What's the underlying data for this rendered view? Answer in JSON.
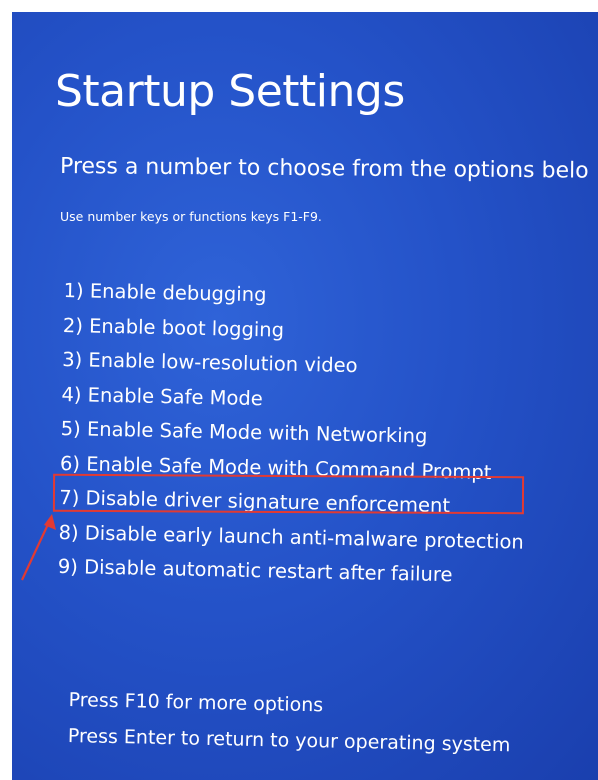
{
  "screen": {
    "title": "Startup Settings",
    "subtitle": "Press a number to choose from the options belo",
    "hint": "Use number keys or functions keys F1-F9."
  },
  "options": [
    {
      "label": "1) Enable debugging"
    },
    {
      "label": "2) Enable boot logging"
    },
    {
      "label": "3) Enable low-resolution video"
    },
    {
      "label": "4) Enable Safe Mode"
    },
    {
      "label": "5) Enable Safe Mode with Networking"
    },
    {
      "label": "6) Enable Safe Mode with Command Prompt"
    },
    {
      "label": "7) Disable driver signature enforcement"
    },
    {
      "label": "8) Disable early launch anti-malware protection"
    },
    {
      "label": "9) Disable automatic restart after failure"
    }
  ],
  "footer": {
    "more_options": "Press F10 for more options",
    "return_os": "Press Enter to return to your operating system"
  },
  "annotation": {
    "highlight_color": "#e23a33",
    "highlighted_option_index": 7
  },
  "colors": {
    "background": "#2452c8",
    "text": "#ffffff"
  }
}
